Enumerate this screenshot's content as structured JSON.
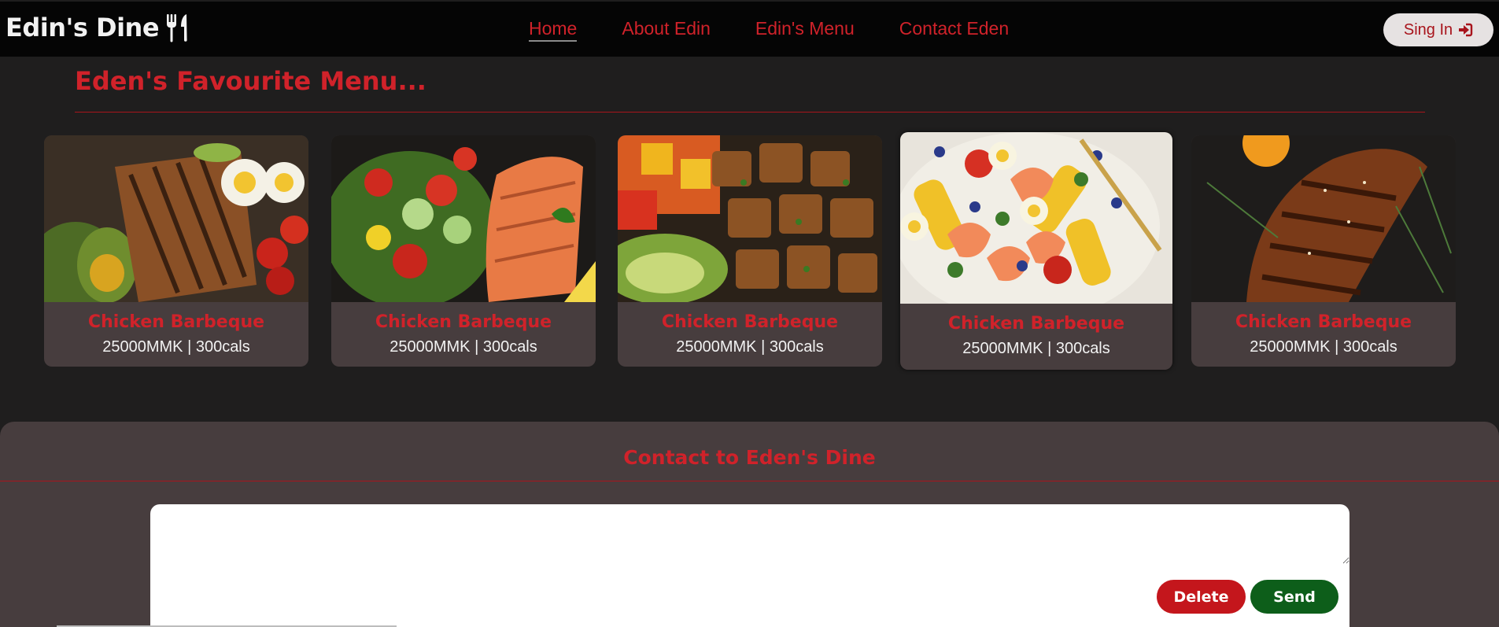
{
  "nav": {
    "brand": "Edin's Dine",
    "links": [
      "Home",
      "About Edin",
      "Edin's Menu",
      "Contact Eden"
    ],
    "active_link": "Home",
    "signin_label": "Sing In"
  },
  "favourites": {
    "title": "Eden's Favourite Menu...",
    "items": [
      {
        "name": "Chicken Barbeque",
        "info": "25000MMK | 300cals",
        "photo": "chicken-egg-avocado-salad"
      },
      {
        "name": "Chicken Barbeque",
        "info": "25000MMK | 300cals",
        "photo": "salmon-salad"
      },
      {
        "name": "Chicken Barbeque",
        "info": "25000MMK | 300cals",
        "photo": "chicken-bites-avocado"
      },
      {
        "name": "Chicken Barbeque",
        "info": "25000MMK | 300cals",
        "photo": "shrimp-corn-salad"
      },
      {
        "name": "Chicken Barbeque",
        "info": "25000MMK | 300cals",
        "photo": "glazed-roast-chicken"
      }
    ]
  },
  "contact": {
    "title": "Contact to Eden's Dine",
    "message_value": "",
    "delete_label": "Delete",
    "send_label": "Send"
  },
  "colors": {
    "accent_red": "#d0222a",
    "card_bg": "#473d3e",
    "page_bg": "#1f1e1e",
    "nav_bg": "#050505",
    "send_green": "#0d5e1a"
  }
}
